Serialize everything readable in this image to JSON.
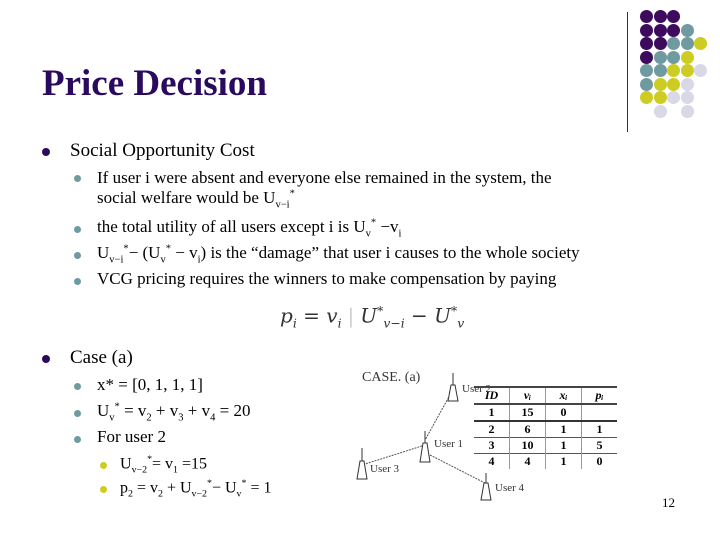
{
  "slide": {
    "title": "Price Decision",
    "page_number": "12",
    "colors": {
      "title": "#2a0a5e",
      "bullet_level1": "#2a0a5e",
      "bullet_level2": "#6f9aa0",
      "bullet_level3": "#cccc22"
    }
  },
  "section1": {
    "heading": "Social Opportunity Cost",
    "items": [
      {
        "line1": "If user i were absent and everyone else remained in the system, the",
        "line2_pre": "social welfare would be U",
        "line2_sub": "v−i",
        "line2_sup": "*"
      },
      {
        "pre": "the total utility of all users except i is U",
        "sub1": "v",
        "sup1": "*",
        "mid": " −v",
        "sub2": "i"
      },
      {
        "a": "U",
        "a_sub": "v−i",
        "a_sup": "*",
        "b": "− (U",
        "b_sub": "v",
        "b_sup": "*",
        "c": " − v",
        "c_sub": "i",
        "d": ") is the “damage” that user i causes to the whole society"
      },
      {
        "text": "VCG pricing requires the winners to make compensation by paying"
      }
    ],
    "formula": {
      "lhs": "p",
      "lhs_sub": "i",
      "eq": " = v",
      "eq_sub": "i",
      "sep": "|",
      "t1": "U",
      "t1_sup": "*",
      "t1_sub": "v−i",
      "minus": " − U",
      "t2_sup": "*",
      "t2_sub": "v"
    }
  },
  "section2": {
    "heading": "Case (a)",
    "items": [
      {
        "text": "x* = [0, 1, 1, 1]"
      },
      {
        "pre": "U",
        "sub": "v",
        "sup": "*",
        "eq": " = v",
        "s2": "2",
        "p1": " + v",
        "s3": "3",
        "p2": " + v",
        "s4": "4",
        "res": " = 20"
      },
      {
        "text": "For user 2"
      }
    ],
    "subitems": [
      {
        "pre": "U",
        "sub": "v−2",
        "sup": "*",
        "rest": "= v",
        "s1": "1",
        "tail": " =15"
      },
      {
        "pre": "p",
        "s": "2",
        "a": " = v",
        "s2": "2",
        "b": " + U",
        "sub": "v−2",
        "sup": "*",
        "c": "− U",
        "sub2": "v",
        "sup2": "*",
        "d": " = 1"
      }
    ]
  },
  "figure": {
    "case_label": "CASE. (a)",
    "users": [
      "User 1",
      "User 2",
      "User 3",
      "User 4"
    ],
    "antenna_glyph": "((·))",
    "table": {
      "headers": [
        "ID",
        "vᵢ",
        "xᵢ",
        "pᵢ"
      ],
      "rows": [
        [
          "1",
          "15",
          "0",
          ""
        ],
        [
          "2",
          "6",
          "1",
          "1"
        ],
        [
          "3",
          "10",
          "1",
          "5"
        ],
        [
          "4",
          "4",
          "1",
          "0"
        ]
      ]
    }
  }
}
